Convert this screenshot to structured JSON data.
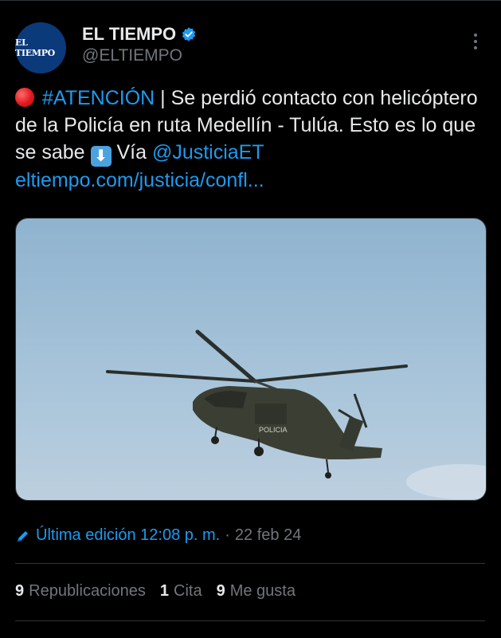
{
  "account": {
    "avatar_text": "EL TIEMPO",
    "name": "EL TIEMPO",
    "handle": "@ELTIEMPO",
    "verified": true,
    "avatar_color": "#0b3a7a"
  },
  "tweet": {
    "hashtag": "#ATENCIÓN",
    "text_part1": " | Se perdió contacto con helicóptero de la Policía en ruta Medellín - Tulúa. Esto es lo que se sabe ",
    "text_part2": " Vía ",
    "mention": "@JusticiaET",
    "url": "eltiempo.com/justicia/confl...",
    "emoji_red_circle": "red-circle-icon",
    "emoji_arrow": "down-arrow-icon"
  },
  "media": {
    "helicopter_label": "POLICIA",
    "description_icon": "helicopter-photo"
  },
  "edit_info": {
    "label": "Última edición 12:08 p. m.",
    "separator": "·",
    "date": "22 feb 24"
  },
  "stats": [
    {
      "count": "9",
      "label": "Republicaciones"
    },
    {
      "count": "1",
      "label": "Cita"
    },
    {
      "count": "9",
      "label": "Me gusta"
    }
  ],
  "colors": {
    "background": "#000000",
    "text": "#e7e9ea",
    "muted": "#71767b",
    "link": "#1d9bf0",
    "divider": "#2f3336"
  }
}
